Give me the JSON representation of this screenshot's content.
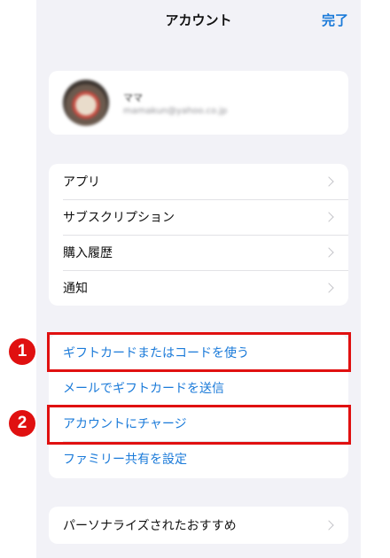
{
  "nav": {
    "title": "アカウント",
    "done": "完了"
  },
  "profile": {
    "name": "ママ",
    "email": "mamakun@yahoo.co.jp"
  },
  "menu": [
    {
      "label": "アプリ"
    },
    {
      "label": "サブスクリプション"
    },
    {
      "label": "購入履歴"
    },
    {
      "label": "通知"
    }
  ],
  "links": [
    {
      "label": "ギフトカードまたはコードを使う"
    },
    {
      "label": "メールでギフトカードを送信"
    },
    {
      "label": "アカウントにチャージ"
    },
    {
      "label": "ファミリー共有を設定"
    }
  ],
  "personalize": {
    "label": "パーソナライズされたおすすめ"
  },
  "annotations": {
    "marker1": "1",
    "marker2": "2"
  },
  "colors": {
    "accent": "#1a7ad9",
    "highlight": "#e01010",
    "background": "#f2f2f7"
  },
  "icons": [
    "chevron-right-icon"
  ]
}
